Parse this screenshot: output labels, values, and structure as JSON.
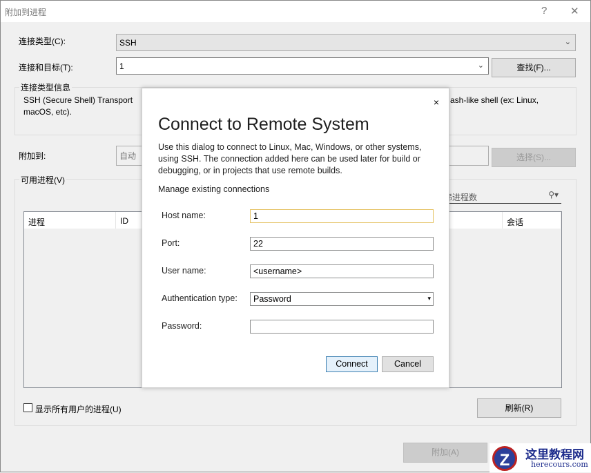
{
  "window": {
    "title": "附加到进程",
    "help": "?",
    "close": "✕"
  },
  "form": {
    "conn_type_label": "连接类型(C):",
    "conn_type_value": "SSH",
    "target_label": "连接和目标(T):",
    "target_value": "1",
    "find_button": "查找(F)...",
    "info_group": "连接类型信息",
    "info_text_left": "SSH (Secure Shell) Transport",
    "info_text_right": "ash-like shell (ex: Linux,",
    "info_text_line2": "macOS, etc).",
    "attach_to_label": "附加到:",
    "attach_to_value": "自动",
    "select_button": "选择(S)...",
    "processes_group": "可用进程(V)",
    "filter_placeholder": "筛进程数",
    "columns": [
      "进程",
      "ID",
      "会话"
    ],
    "show_all_label": "显示所有用户的进程(U)",
    "refresh_button": "刷新(R)",
    "attach_button": "附加(A)"
  },
  "modal": {
    "title": "Connect to Remote System",
    "description": "Use this dialog to connect to Linux, Mac, Windows, or other systems, using SSH. The connection added here can be used later for build or debugging, or in projects that use remote builds.",
    "manage_link": "Manage existing connections",
    "fields": [
      {
        "label": "Host name:",
        "value": "1"
      },
      {
        "label": "Port:",
        "value": "22"
      },
      {
        "label": "User name:",
        "value": "<username>"
      },
      {
        "label": "Authentication type:",
        "value": "Password"
      },
      {
        "label": "Password:",
        "value": ""
      }
    ],
    "connect": "Connect",
    "cancel": "Cancel",
    "close": "×"
  },
  "watermark": {
    "cn": "这里教程网",
    "en": "herecours.com"
  }
}
